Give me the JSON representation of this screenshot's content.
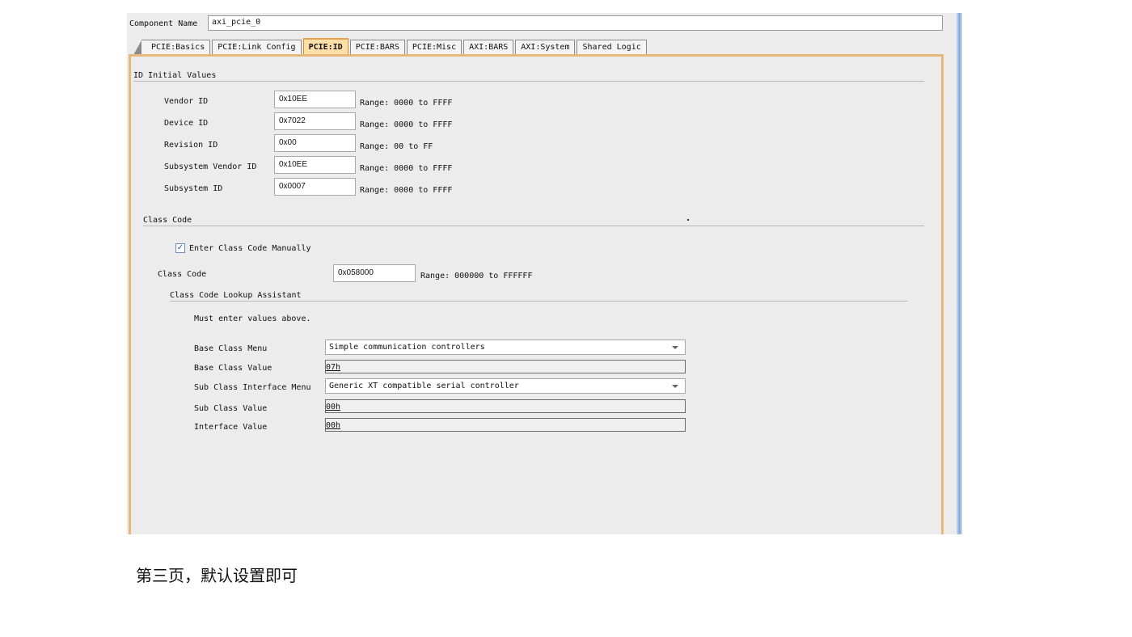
{
  "component": {
    "label": "Component Name",
    "value": "axi_pcie_0"
  },
  "tabs": [
    {
      "label": "PCIE:Basics",
      "active": false
    },
    {
      "label": "PCIE:Link Config",
      "active": false
    },
    {
      "label": "PCIE:ID",
      "active": true
    },
    {
      "label": "PCIE:BARS",
      "active": false
    },
    {
      "label": "PCIE:Misc",
      "active": false
    },
    {
      "label": "AXI:BARS",
      "active": false
    },
    {
      "label": "AXI:System",
      "active": false
    },
    {
      "label": "Shared Logic",
      "active": false
    }
  ],
  "id_section": {
    "title": "ID Initial Values",
    "fields": [
      {
        "label": "Vendor ID",
        "value": "0x10EE",
        "range": "Range: 0000 to FFFF"
      },
      {
        "label": "Device ID",
        "value": "0x7022",
        "range": "Range: 0000 to FFFF"
      },
      {
        "label": "Revision ID",
        "value": "0x00",
        "range": "Range: 00 to FF"
      },
      {
        "label": "Subsystem Vendor ID",
        "value": "0x10EE",
        "range": "Range: 0000 to FFFF"
      },
      {
        "label": "Subsystem ID",
        "value": "0x0007",
        "range": "Range: 0000 to FFFF"
      }
    ]
  },
  "class_section": {
    "title": "Class Code",
    "manual_checkbox": {
      "label": "Enter Class Code Manually",
      "checked": true
    },
    "class_code": {
      "label": "Class Code",
      "value": "0x058000",
      "range": "Range: 000000 to FFFFFF"
    },
    "lookup": {
      "title": "Class Code Lookup Assistant",
      "note": "Must enter values above.",
      "base_class_menu": {
        "label": "Base Class Menu",
        "value": "Simple communication controllers"
      },
      "base_class_value": {
        "label": "Base Class Value",
        "value": "07h"
      },
      "sub_class_interface_menu": {
        "label": "Sub Class Interface Menu",
        "value": "Generic XT compatible serial controller"
      },
      "sub_class_value": {
        "label": "Sub Class Value",
        "value": "00h"
      },
      "interface_value": {
        "label": "Interface Value",
        "value": "00h"
      }
    }
  },
  "caption": "第三页，默认设置即可",
  "colors": {
    "active_tab": "#ffdfa8",
    "panel_border": "#e7b77c",
    "background": "#ececec"
  }
}
